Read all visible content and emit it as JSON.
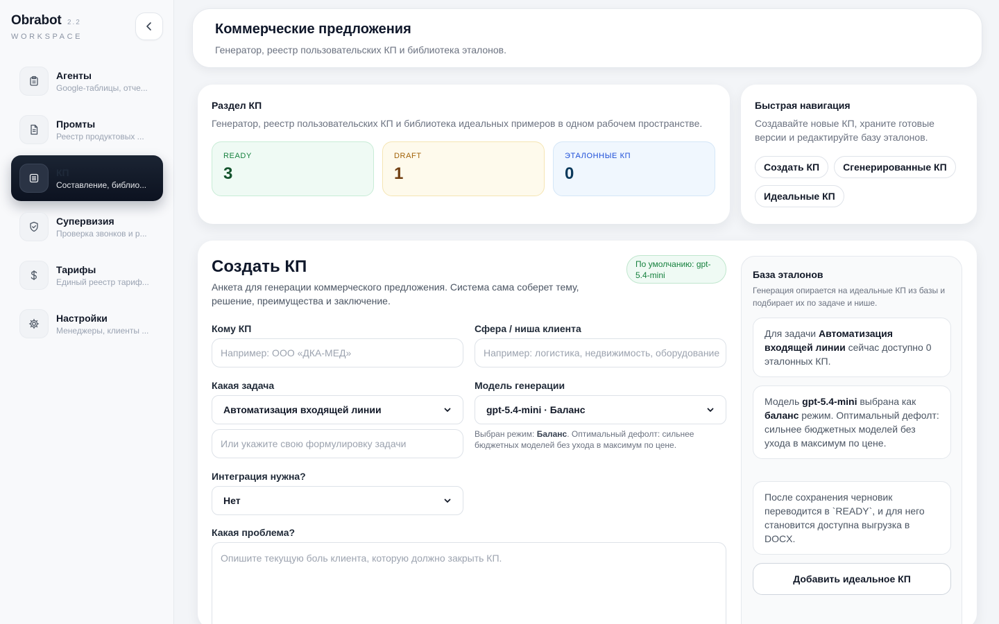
{
  "brand": {
    "title": "Obrabot",
    "version": "2.2",
    "subtitle": "WORKSPACE"
  },
  "sidebar": {
    "items": [
      {
        "label": "Агенты",
        "desc": "Google-таблицы, отче...",
        "icon": "clipboard-icon"
      },
      {
        "label": "Промты",
        "desc": "Реестр продуктовых ...",
        "icon": "document-icon"
      },
      {
        "label": "КП",
        "desc": "Составление, библио...",
        "icon": "list-document-icon",
        "active": true
      },
      {
        "label": "Супервизия",
        "desc": "Проверка звонков и р...",
        "icon": "shield-check-icon"
      },
      {
        "label": "Тарифы",
        "desc": "Единый реестр тариф...",
        "icon": "dollar-icon"
      },
      {
        "label": "Настройки",
        "desc": "Менеджеры, клиенты ...",
        "icon": "gear-icon"
      }
    ]
  },
  "header": {
    "title": "Коммерческие предложения",
    "subtitle": "Генератор, реестр пользовательских КП и библиотека эталонов."
  },
  "section": {
    "title": "Раздел КП",
    "desc": "Генератор, реестр пользовательских КП и библиотека идеальных примеров в одном рабочем пространстве.",
    "stats": [
      {
        "label": "READY",
        "value": "3"
      },
      {
        "label": "DRAFT",
        "value": "1"
      },
      {
        "label": "ЭТАЛОННЫЕ КП",
        "value": "0"
      }
    ]
  },
  "quick_nav": {
    "title": "Быстрая навигация",
    "desc": "Создавайте новые КП, храните готовые версии и редактируйте базу эталонов.",
    "chips": [
      "Создать КП",
      "Сгенерированные КП",
      "Идеальные КП"
    ]
  },
  "form": {
    "title": "Создать КП",
    "desc": "Анкета для генерации коммерческого предложения. Система сама соберет тему, решение, преимущества и заключение.",
    "default_badge": "По умолчанию: gpt-5.4-mini",
    "to_label": "Кому КП",
    "to_placeholder": "Например: ООО «ДКА-МЕД»",
    "niche_label": "Сфера / ниша клиента",
    "niche_placeholder": "Например: логистика, недвижимость, оборудование",
    "task_label": "Какая задача",
    "task_value": "Автоматизация входящей линии",
    "task_custom_placeholder": "Или укажите свою формулировку задачи",
    "model_label": "Модель генерации",
    "model_value": "gpt-5.4-mini · Баланс",
    "model_hint_prefix": "Выбран режим:",
    "model_hint_mode": "Баланс",
    "model_hint_rest": ". Оптимальный дефолт: сильнее бюджетных моделей без ухода в максимум по цене.",
    "integration_label": "Интеграция нужна?",
    "integration_value": "Нет",
    "problem_label": "Какая проблема?",
    "problem_placeholder": "Опишите текущую боль клиента, которую должно закрыть КП."
  },
  "base": {
    "title": "База эталонов",
    "desc": "Генерация опирается на идеальные КП из базы и подбирает их по задаче и нише.",
    "box1_a": "Для задачи ",
    "box1_b": "Автоматизация входящей линии",
    "box1_c": " сейчас доступно 0 эталонных КП.",
    "box2_a": "Модель ",
    "box2_b": "gpt-5.4-mini",
    "box2_c": " выбрана как ",
    "box2_d": "баланс",
    "box2_e": " режим. Оптимальный дефолт: сильнее бюджетных моделей без ухода в максимум по цене.",
    "box3": "После сохранения черновик переводится в `READY`, и для него становится доступна выгрузка в DOCX.",
    "add_button": "Добавить идеальное КП"
  }
}
